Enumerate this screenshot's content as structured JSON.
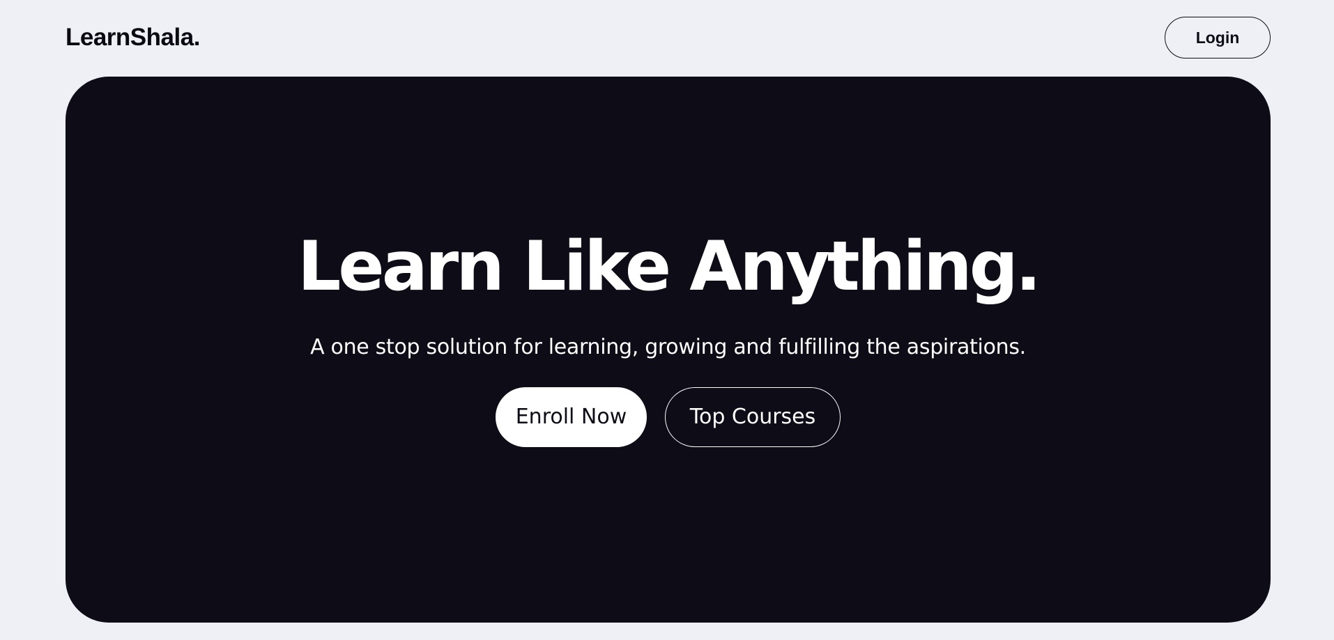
{
  "header": {
    "brand": "LearnShala.",
    "login_label": "Login"
  },
  "hero": {
    "title": "Learn Like Anything.",
    "subtitle": "A one stop solution for learning, growing and fulfilling the aspirations.",
    "primary_cta": "Enroll Now",
    "secondary_cta": "Top Courses"
  },
  "colors": {
    "background": "#eff0f5",
    "hero_background": "#0d0c17",
    "text_dark": "#0d0c17",
    "text_light": "#ffffff"
  }
}
